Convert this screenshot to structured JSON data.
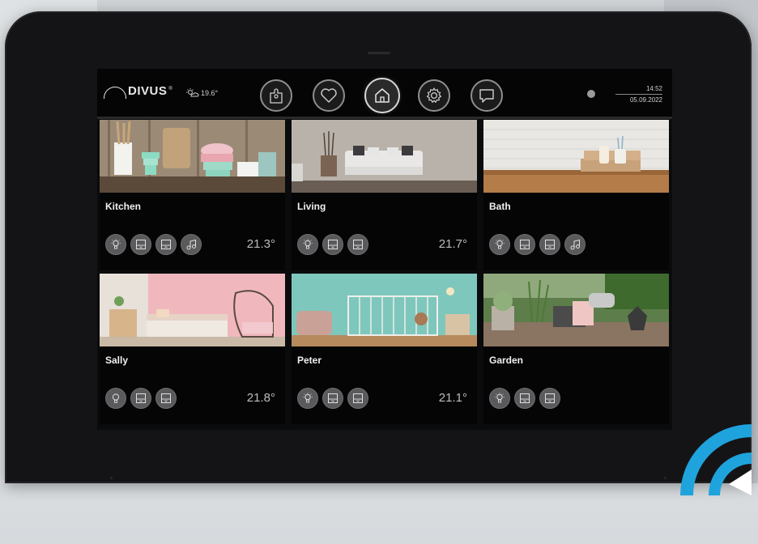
{
  "app": {
    "logo": "DIVUS",
    "logo_mark": "®"
  },
  "weather": {
    "icon": "sun-cloud-icon",
    "temperature": "19.6°"
  },
  "nav": [
    {
      "name": "scenarios",
      "icon": "puzzle-icon",
      "active": false
    },
    {
      "name": "favorites",
      "icon": "heart-icon",
      "active": false
    },
    {
      "name": "home",
      "icon": "house-icon",
      "active": true
    },
    {
      "name": "settings",
      "icon": "gear-icon",
      "active": false
    },
    {
      "name": "messages",
      "icon": "chat-bubble-icon",
      "active": false
    }
  ],
  "clock": {
    "time": "14:52",
    "date": "05.09.2022"
  },
  "rooms": [
    {
      "name": "Kitchen",
      "temp": "21.3°",
      "controls": [
        "bulb-icon",
        "blind-down-icon",
        "blind-up-icon",
        "music-icon"
      ]
    },
    {
      "name": "Living",
      "temp": "21.7°",
      "controls": [
        "bulb-icon",
        "blind-down-icon",
        "blind-down-icon"
      ]
    },
    {
      "name": "Bath",
      "temp": "",
      "controls": [
        "bulb-icon",
        "blind-down-icon",
        "blind-up-icon",
        "music-icon"
      ]
    },
    {
      "name": "Sally",
      "temp": "21.8°",
      "controls": [
        "bulb-icon",
        "blind-down-icon",
        "blind-down-icon"
      ]
    },
    {
      "name": "Peter",
      "temp": "21.1°",
      "controls": [
        "bulb-icon",
        "blind-down-icon",
        "blind-down-icon"
      ]
    },
    {
      "name": "Garden",
      "temp": "",
      "controls": [
        "bulb-icon",
        "blind-down-icon",
        "blind-down-icon"
      ]
    }
  ],
  "colors": {
    "accent": "#1fa3dc",
    "bezel": "#141416",
    "card": "#050505"
  }
}
